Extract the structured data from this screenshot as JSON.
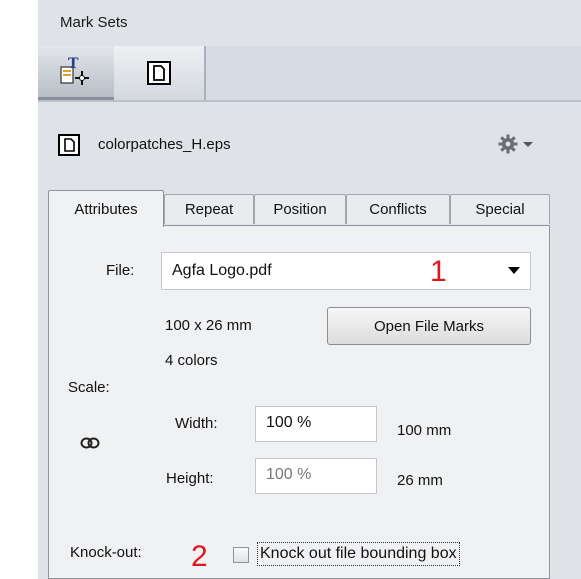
{
  "header": {
    "title": "Mark Sets"
  },
  "toolbar": {
    "items": [
      {
        "name": "add-text-mark",
        "icon": "text-mark-add-icon"
      },
      {
        "name": "file-mark",
        "icon": "file-mark-icon"
      }
    ]
  },
  "file": {
    "name": "colorpatches_H.eps",
    "menu_icon": "gear-dropdown-icon"
  },
  "tabs": [
    {
      "label": "Attributes",
      "active": true
    },
    {
      "label": "Repeat"
    },
    {
      "label": "Position"
    },
    {
      "label": "Conflicts"
    },
    {
      "label": "Special"
    }
  ],
  "attributes": {
    "file_label": "File:",
    "file_value": "Agfa Logo.pdf",
    "annotation_1": "1",
    "size": "100 x 26 mm",
    "colors": "4 colors",
    "open_button": "Open File Marks",
    "scale_label": "Scale:",
    "width_label": "Width:",
    "width_value": "100 %",
    "width_mm": "100 mm",
    "height_label": "Height:",
    "height_value": "100 %",
    "height_mm": "26 mm",
    "knockout_label": "Knock-out:",
    "annotation_2": "2",
    "knockout_checkbox_label": "Knock out file bounding box",
    "knockout_checked": false
  },
  "colors": {
    "panel_bg": "#dfe3e8",
    "annotation_red": "#e0161c"
  }
}
